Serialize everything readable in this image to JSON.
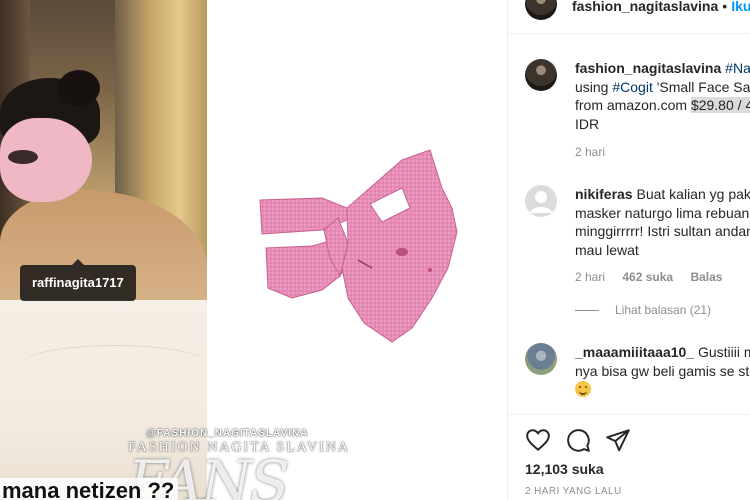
{
  "post": {
    "tag_username": "raffinagita1717",
    "watermark_handle": "@FASHION_NAGITASLAVINA",
    "watermark_name": "FASHION NAGITA SLAVINA",
    "watermark_fans": "FANS",
    "overlay_caption": "mana netizen ??"
  },
  "header": {
    "username": "fashion_nagitaslavina",
    "separator": "•",
    "follow_label": "Ikuti"
  },
  "caption": {
    "username": "fashion_nagitaslavina",
    "hashtag1": "#Nagi",
    "text_using": "using",
    "hashtag2": "#Cogit",
    "text_product": "'Small Face Sau",
    "text_from": "from amazon.com",
    "price": "$29.80 / 4",
    "text_idr": "IDR",
    "time": "2 hari"
  },
  "comments": [
    {
      "username": "nikiferas",
      "text": "Buat kalian yg pake masker naturgo lima rebuan minggirrrrr! Istri sultan andan mau lewat",
      "time": "2 hari",
      "likes": "462 suka",
      "reply_label": "Balas"
    },
    {
      "username": "_maaamiiitaaa10_",
      "text": "Gustiiii ma nya bisa gw beli gamis se ste",
      "emoji": "grin-sweat-emoji"
    }
  ],
  "replies_label": "Lihat balasan (21)",
  "actions": {
    "likes": "12,103 suka",
    "date": "2 HARI YANG LALU"
  },
  "colors": {
    "link_blue": "#0095f6",
    "hashtag_blue": "#00376b",
    "meta_grey": "#8e8e8e",
    "mask_pink": "#e68cb6"
  }
}
